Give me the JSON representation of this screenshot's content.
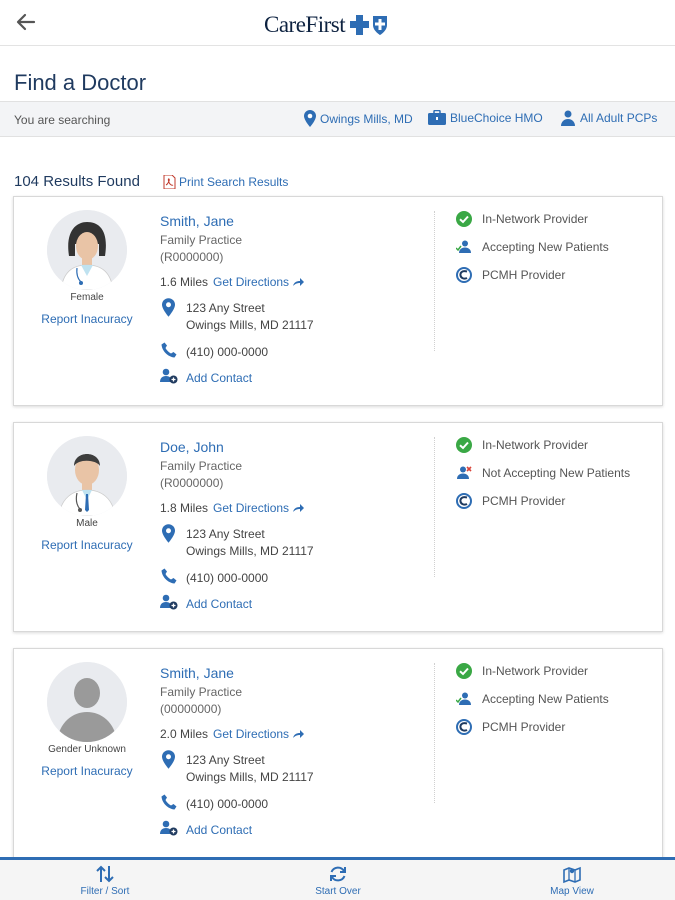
{
  "header": {
    "back_icon": "arrow-left-icon",
    "logo_text": "CareFirst"
  },
  "page": {
    "title": "Find a Doctor"
  },
  "search": {
    "label": "You are searching",
    "location": "Owings Mills, MD",
    "plan": "BlueChoice HMO",
    "provider_type": "All Adult PCPs"
  },
  "results": {
    "count_text": "104 Results Found",
    "print_label": "Print Search Results"
  },
  "doctors": [
    {
      "name": "Smith, Jane",
      "specialty": "Family Practice",
      "id": "(R0000000)",
      "distance": "1.6 Miles",
      "directions": "Get Directions",
      "address1": "123 Any Street",
      "address2": "Owings Mills, MD 21117",
      "phone": "(410) 000-0000",
      "add_contact": "Add Contact",
      "gender": "Female",
      "report": "Report Inacuracy",
      "statuses": [
        "In-Network Provider",
        "Accepting New Patients",
        "PCMH Provider"
      ]
    },
    {
      "name": "Doe, John",
      "specialty": "Family Practice",
      "id": "(R0000000)",
      "distance": "1.8 Miles",
      "directions": "Get Directions",
      "address1": "123 Any Street",
      "address2": "Owings Mills, MD 21117",
      "phone": "(410) 000-0000",
      "add_contact": "Add Contact",
      "gender": "Male",
      "report": "Report Inacuracy",
      "statuses": [
        "In-Network Provider",
        "Not Accepting New Patients",
        "PCMH Provider"
      ]
    },
    {
      "name": "Smith, Jane",
      "specialty": "Family Practice",
      "id": "(00000000)",
      "distance": "2.0 Miles",
      "directions": "Get Directions",
      "address1": "123 Any Street",
      "address2": "Owings Mills, MD 21117",
      "phone": "(410) 000-0000",
      "add_contact": "Add Contact",
      "gender": "Gender Unknown",
      "report": "Report Inacuracy",
      "statuses": [
        "In-Network Provider",
        "Accepting New Patients",
        "PCMH Provider"
      ]
    }
  ],
  "bottom_nav": {
    "filter_sort": "Filter / Sort",
    "start_over": "Start Over",
    "map_view": "Map View"
  },
  "colors": {
    "accent": "#2e6db4",
    "in_network_green": "#3aa845",
    "not_accepting_red": "#d9443a",
    "title_navy": "#1f3a5f"
  }
}
